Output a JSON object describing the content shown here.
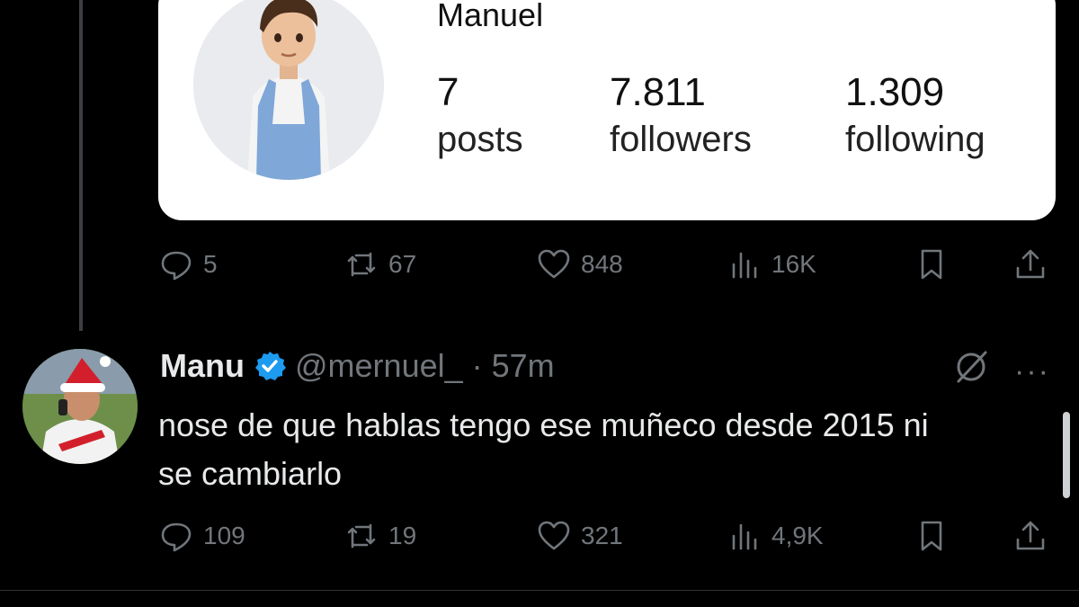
{
  "card": {
    "name": "Manuel",
    "stats": [
      {
        "num": "7",
        "label": "posts"
      },
      {
        "num": "7.811",
        "label": "followers"
      },
      {
        "num": "1.309",
        "label": "following"
      }
    ]
  },
  "post_actions": {
    "replies": "5",
    "reposts": "67",
    "likes": "848",
    "views": "16K"
  },
  "reply": {
    "name": "Manu",
    "handle": "@mernuel_",
    "dot": "·",
    "time": "57m",
    "text": "nose de que hablas tengo ese muñeco desde 2015 ni se cambiarlo",
    "actions": {
      "replies": "109",
      "reposts": "19",
      "likes": "321",
      "views": "4,9K"
    }
  },
  "colors": {
    "background": "#000000",
    "muted": "#71767b",
    "verified": "#1d9bf0"
  }
}
